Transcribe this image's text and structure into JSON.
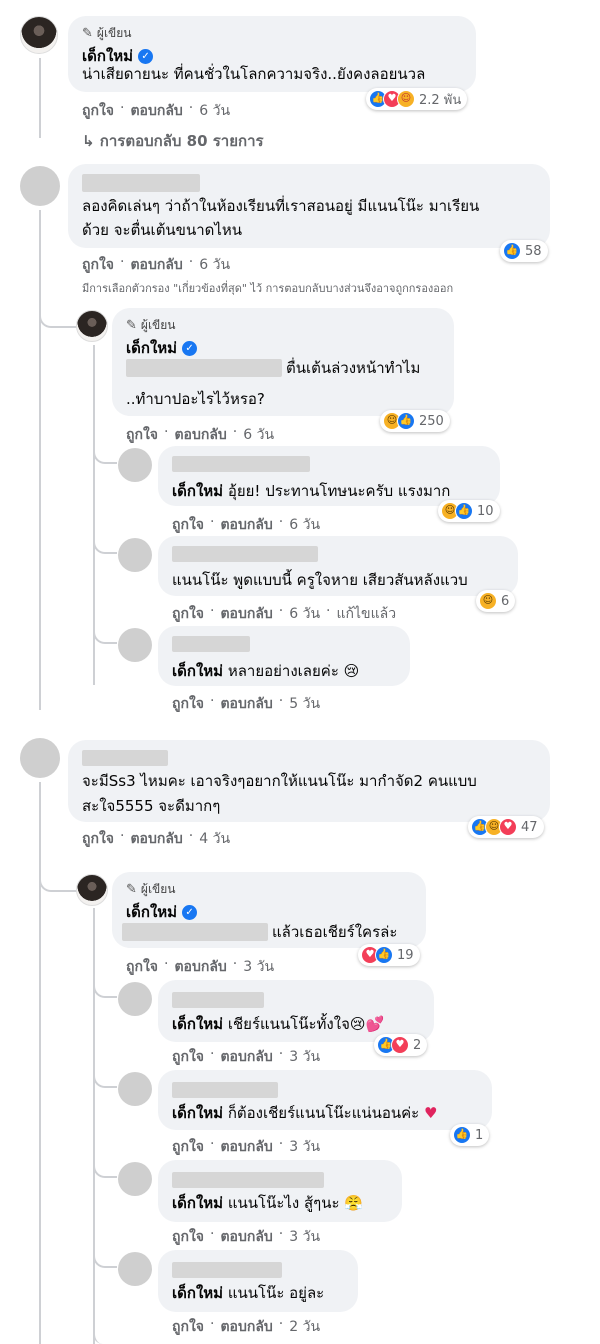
{
  "author_tag": "ผู้เขียน",
  "verified_name": "เด็กใหม่",
  "comments": {
    "c1": {
      "text": "น่าเสียดายนะ ที่คนชั่วในโลกความจริง..ยังคงลอยนวล",
      "like": "ถูกใจ",
      "reply": "ตอบกลับ",
      "time": "6 วัน",
      "reactions": "2.2 พัน",
      "replies_link": "↳ การตอบกลับ 80 รายการ"
    },
    "c2": {
      "line1": "ลองคิดเล่นๆ ว่าถ้าในห้องเรียนที่เราสอนอยู่ มีแนนโน๊ะ มาเรียน",
      "line2": "ด้วย จะตื่นเต้นขนาดไหน",
      "like": "ถูกใจ",
      "reply": "ตอบกลับ",
      "time": "6 วัน",
      "reactions": "58",
      "filter_note": "มีการเลือกตัวกรอง \"เกี่ยวข้องที่สุด\" ไว้ การตอบกลับบางส่วนจึงอาจถูกกรองออก"
    },
    "r1": {
      "line1": "ตื่นเต้นล่วงหน้าทำไม",
      "line2": "..ทำบาปอะไรไว้หรอ?",
      "like": "ถูกใจ",
      "reply": "ตอบกลับ",
      "time": "6 วัน",
      "reactions": "250"
    },
    "r2": {
      "text": "อุ้ยย! ประทานโทษนะครับ แรงมาก",
      "like": "ถูกใจ",
      "reply": "ตอบกลับ",
      "time": "6 วัน",
      "reactions": "10"
    },
    "r3": {
      "text": "แนนโน๊ะ พูดแบบนี้ ครูใจหาย เสียวสันหลังแวบ",
      "like": "ถูกใจ",
      "reply": "ตอบกลับ",
      "time": "6 วัน",
      "edited": "แก้ไขแล้ว",
      "reactions": "6"
    },
    "r4": {
      "text": "หลายอย่างเลยค่ะ",
      "like": "ถูกใจ",
      "reply": "ตอบกลับ",
      "time": "5 วัน"
    },
    "c3": {
      "line1": "จะมีSs3 ไหมคะ เอาจริงๆอยากให้แนนโน๊ะ มากำจัด2 คนแบบ",
      "line2": "สะใจ5555 จะดีมากๆ",
      "like": "ถูกใจ",
      "reply": "ตอบกลับ",
      "time": "4 วัน",
      "reactions": "47"
    },
    "r5": {
      "text": "แล้วเธอเชียร์ใครล่ะ",
      "like": "ถูกใจ",
      "reply": "ตอบกลับ",
      "time": "3 วัน",
      "reactions": "19"
    },
    "r6": {
      "text": "เชียร์แนนโน๊ะทั้งใจ",
      "like": "ถูกใจ",
      "reply": "ตอบกลับ",
      "time": "3 วัน",
      "reactions": "2"
    },
    "r7": {
      "text": "ก็ต้องเชียร์แนนโน๊ะแน่นอนค่ะ",
      "like": "ถูกใจ",
      "reply": "ตอบกลับ",
      "time": "3 วัน",
      "reactions": "1"
    },
    "r8": {
      "text": "แนนโน๊ะไง สู้ๆนะ",
      "like": "ถูกใจ",
      "reply": "ตอบกลับ",
      "time": "3 วัน"
    },
    "r9": {
      "text": "แนนโน๊ะ อยู่ละ",
      "like": "ถูกใจ",
      "reply": "ตอบกลับ",
      "time": "2 วัน"
    }
  },
  "meta_separator": "·",
  "icons": [
    "pencil-icon",
    "verified-badge-icon",
    "like-reaction-icon",
    "love-reaction-icon",
    "haha-reaction-icon",
    "care-reaction-icon",
    "reply-arrow-icon"
  ],
  "colors": {
    "bubble": "#f0f2f5",
    "link": "#65676b",
    "verified": "#1877f2",
    "placeholder": "#d6d6d6"
  }
}
